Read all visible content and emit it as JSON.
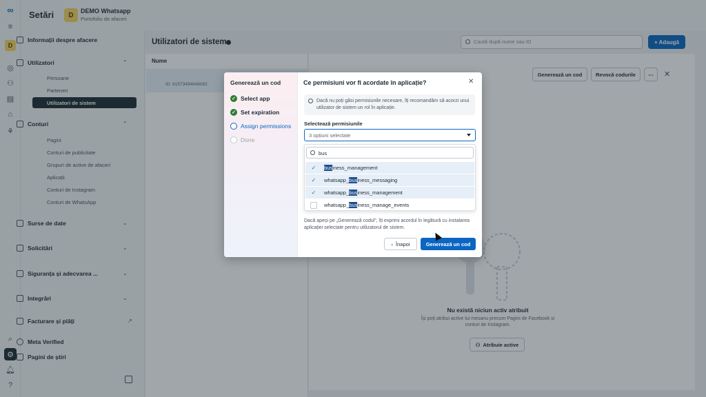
{
  "app": {
    "logo_icon": "meta-logo-icon",
    "settings_title": "Setări",
    "business_initial": "D",
    "business_name": "DEMO Whatsapp",
    "business_subtitle": "Portofoliu de afaceri"
  },
  "rail": {
    "icons": [
      "menu-icon",
      "business-avatar",
      "home-icon",
      "people-icon",
      "documents-icon",
      "store-icon",
      "network-icon",
      "search-icon",
      "settings-icon",
      "notifications-icon",
      "help-icon"
    ]
  },
  "sidebar": {
    "business_info": "Informații despre afacere",
    "users_section": "Utilizatori",
    "users_items": [
      "Persoane",
      "Parteneri",
      "Utilizatori de sistem"
    ],
    "accounts_section": "Conturi",
    "accounts_items": [
      "Pagini",
      "Conturi de publicitate",
      "Grupuri de active de afaceri",
      "Aplicații",
      "Conturi de Instagram",
      "Conturi de WhatsApp"
    ],
    "data_sources": "Surse de date",
    "requests": "Solicitări",
    "security": "Siguranța și adecvarea ...",
    "integrations": "Integrări",
    "billing": "Facturare și plăți",
    "meta_verified": "Meta Verified",
    "news_pages": "Pagini de știri"
  },
  "main": {
    "title": "Utilizatori de sistem",
    "search_placeholder": "Caută după nume sau ID",
    "add_button": "+ Adaugă",
    "name_column": "Nume",
    "row_id": "ID: 61573494848082",
    "generate_code_button": "Generează un cod",
    "revoke_codes_button": "Revocă codurile",
    "more_button": "⋯",
    "empty_title": "Nu există niciun activ atribuit",
    "empty_desc": "Își poți atribui active lui mesanu precum Pagini de Facebook și conturi de Instagram.",
    "assign_assets_button": "Atribuie active"
  },
  "modal": {
    "steps_title": "Generează un cod",
    "steps": [
      {
        "label": "Select app",
        "state": "done"
      },
      {
        "label": "Set expiration",
        "state": "done"
      },
      {
        "label": "Assign permissions",
        "state": "active"
      },
      {
        "label": "Done",
        "state": "todo"
      }
    ],
    "heading": "Ce permisiuni vor fi acordate în aplicație?",
    "notice": "Dacă nu poți găsi permisiunile necesare, îți recomandăm să acorzi unui utilizator de sistem un rol în aplicație.",
    "select_label": "Selectează permisiunile",
    "select_value": "3 opțiuni selectate",
    "search_value": "bus",
    "options": [
      {
        "pre": "",
        "match": "bus",
        "post": "iness_management",
        "checked": true
      },
      {
        "pre": "whatsapp_",
        "match": "bus",
        "post": "iness_messaging",
        "checked": true
      },
      {
        "pre": "whatsapp_",
        "match": "bus",
        "post": "iness_management",
        "checked": true
      },
      {
        "pre": "whatsapp_",
        "match": "bus",
        "post": "iness_manage_events",
        "checked": false
      }
    ],
    "consent": "Dacă apeși pe „Generează codul”, îți exprimi acordul în legătură cu instalarea aplicației selectate pentru utilizatorul de sistem.",
    "back_button": "Înapoi",
    "generate_button": "Generează un cod"
  },
  "colors": {
    "primary": "#0a66c2",
    "done_step": "#2e7d32",
    "highlight": "#1f4e8c"
  }
}
